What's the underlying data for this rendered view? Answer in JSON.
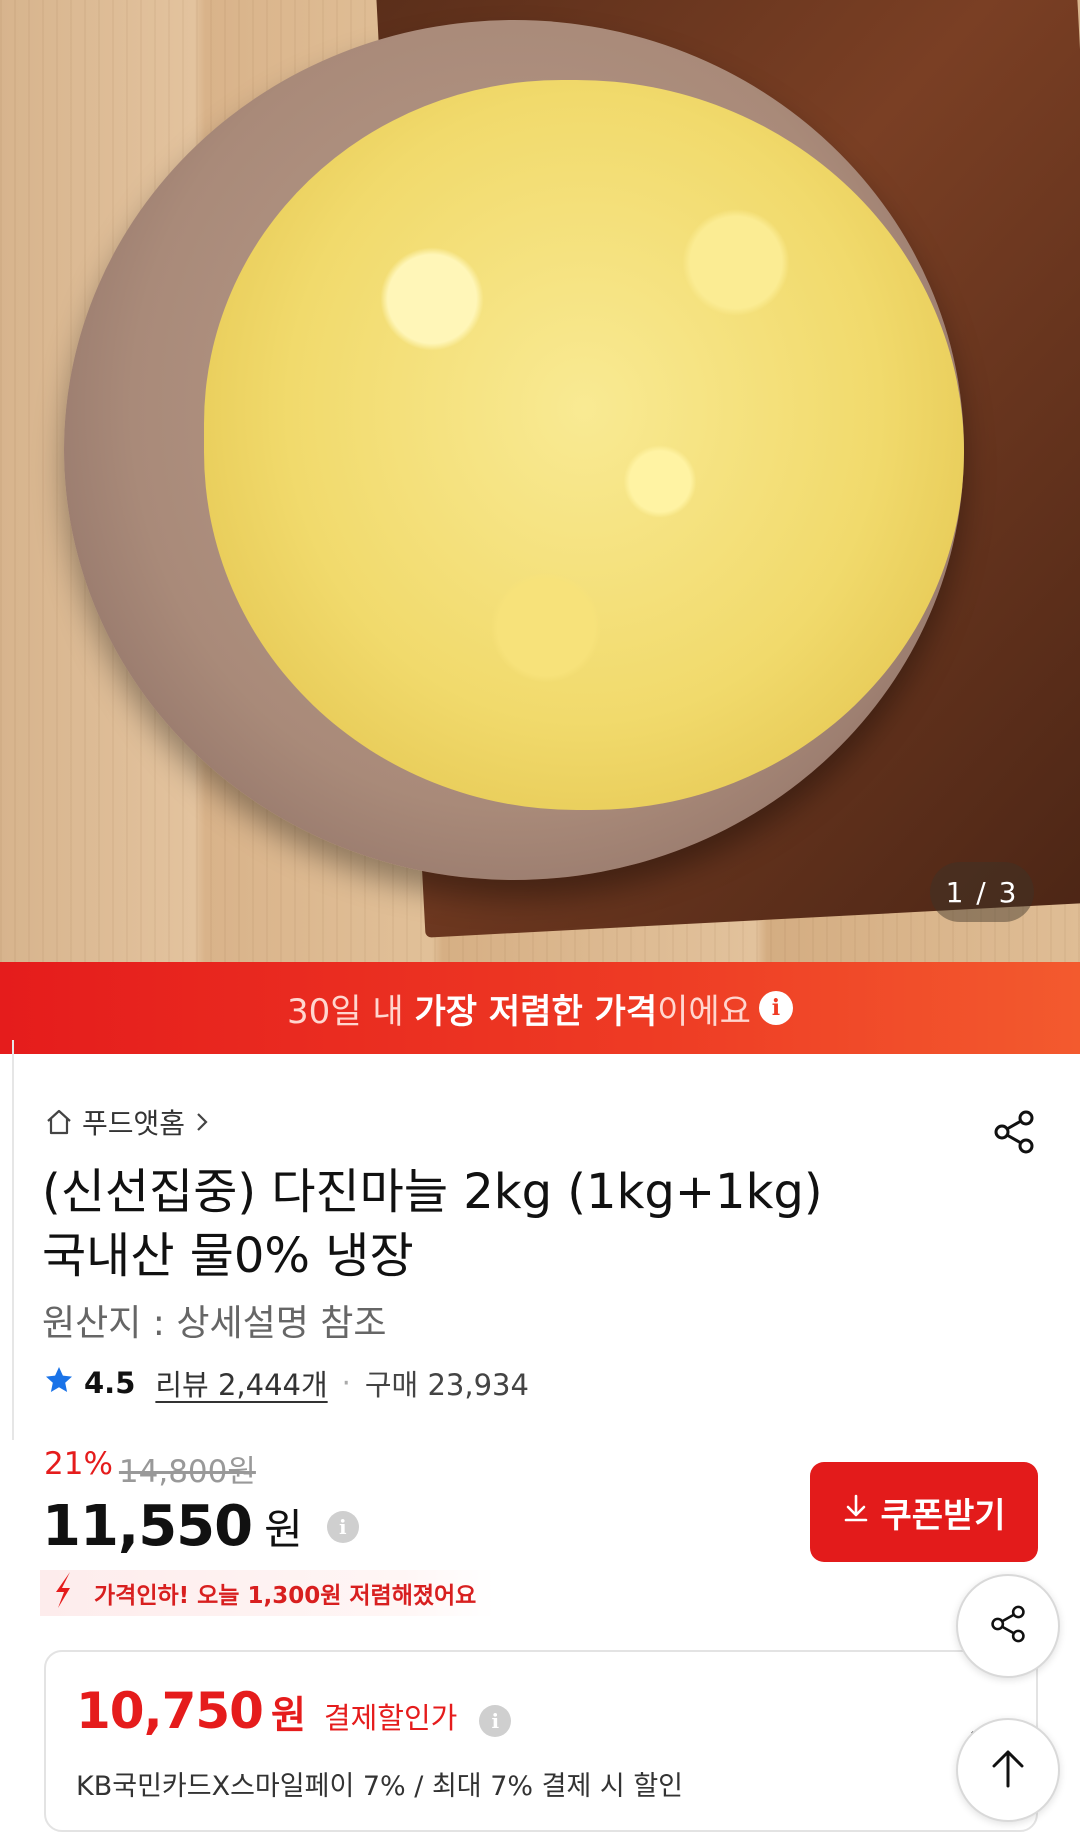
{
  "hero": {
    "image_counter": "1 / 3"
  },
  "banner": {
    "text_before": "30일 내 ",
    "text_bold": "가장 저렴한 가격",
    "text_after": "이에요",
    "info_glyph": "i"
  },
  "breadcrumb": {
    "store": "푸드앳홈",
    "icon": "home-icon"
  },
  "product": {
    "title_line1": "(신선집중) 다진마늘 2kg (1kg+1kg)",
    "title_line2": "국내산 물0% 냉장",
    "origin": "원산지 : 상세설명 참조"
  },
  "rating": {
    "score": "4.5",
    "review_label": "리뷰 2,444개",
    "purchase_label": "구매 23,934",
    "star_color": "#1a73e8"
  },
  "pricing": {
    "discount_rate": "21%",
    "original_price": "14,800원",
    "sale_amount": "11,550",
    "sale_unit": "원",
    "price_drop_msg": "가격인하! 오늘 1,300원 저렴해졌어요",
    "accent_color": "#e51c1c"
  },
  "coupon": {
    "label": "쿠폰받기"
  },
  "payment": {
    "amount": "10,750",
    "unit": "원",
    "label": "결제할인가",
    "desc": "KB국민카드X스마일페이 7% / 최대 7% 결제 시 할인"
  }
}
